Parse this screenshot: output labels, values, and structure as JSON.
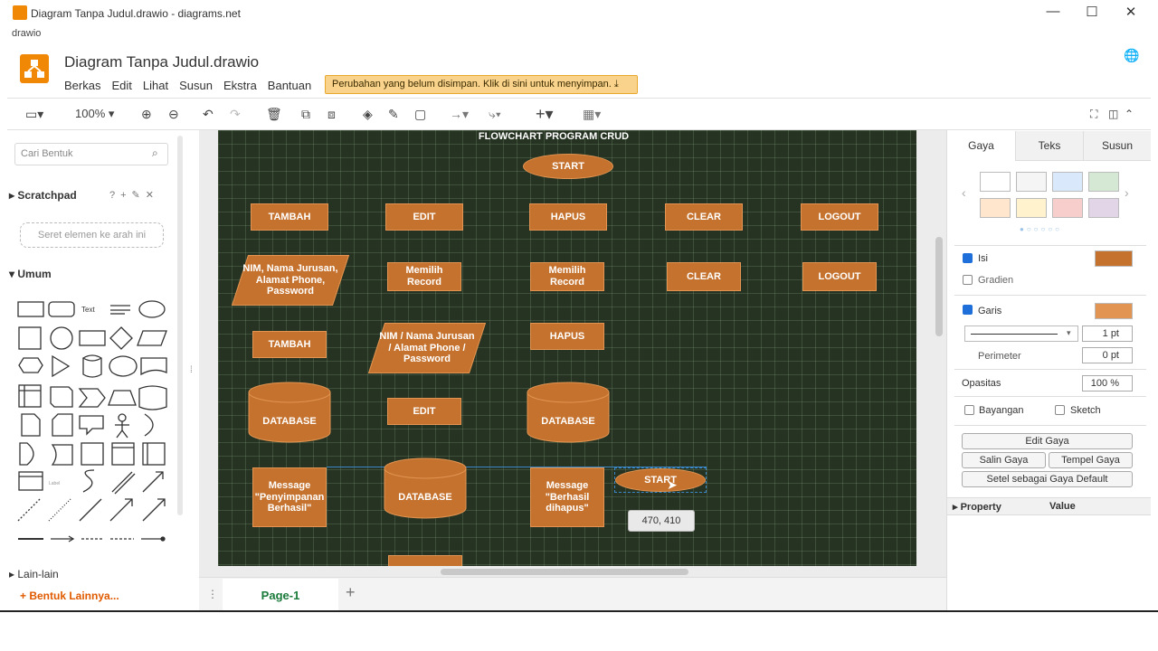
{
  "window": {
    "title": "Diagram Tanpa Judul.drawio - diagrams.net",
    "app_label": "drawio",
    "minimize": "—",
    "maximize": "☐",
    "close": "✕"
  },
  "header": {
    "doc_title": "Diagram Tanpa Judul.drawio",
    "menus": [
      "Berkas",
      "Edit",
      "Lihat",
      "Susun",
      "Ekstra",
      "Bantuan"
    ],
    "unsaved_notice": "Perubahan yang belum disimpan. Klik di sini untuk menyimpan."
  },
  "toolbar": {
    "zoom": "100%"
  },
  "left": {
    "search_placeholder": "Cari Bentuk",
    "scratchpad_title": "Scratchpad",
    "scratch_drop": "Seret elemen ke arah ini",
    "general_title": "Umum",
    "other_title": "Lain-lain",
    "more_shapes": "Bentuk Lainnya..."
  },
  "diagram": {
    "title": "FLOWCHART PROGRAM CRUD",
    "nodes": {
      "start_top": "START",
      "tambah1": "TAMBAH",
      "edit1": "EDIT",
      "hapus1": "HAPUS",
      "clear1": "CLEAR",
      "logout1": "LOGOUT",
      "input1": "NIM, Nama Jurusan, Alamat Phone, Password",
      "memilih1": "Memilih Record",
      "memilih2": "Memilih Record",
      "clear2": "CLEAR",
      "logout2": "LOGOUT",
      "tambah2": "TAMBAH",
      "input2": "NIM / Nama Jurusan / Alamat Phone / Password",
      "hapus2": "HAPUS",
      "db1": "DATABASE",
      "edit2": "EDIT",
      "db2": "DATABASE",
      "msg1": "Message \"Penyimpanan Berhasil\"",
      "db3": "DATABASE",
      "msg2": "Message \"Berhasil dihapus\"",
      "start_drag": "START"
    },
    "coord_tooltip": "470, 410"
  },
  "page_tab": "Page-1",
  "right": {
    "tabs": [
      "Gaya",
      "Teks",
      "Susun"
    ],
    "swatches": [
      "#ffffff",
      "#f5f5f5",
      "#dae8fc",
      "#d5e8d4",
      "#ffe6cc",
      "#fff2cc",
      "#f8cecc",
      "#e1d5e7"
    ],
    "fill_label": "Isi",
    "fill_color": "#c5722e",
    "gradient_label": "Gradien",
    "line_label": "Garis",
    "line_color": "#e29552",
    "line_width": "1 pt",
    "perimeter_label": "Perimeter",
    "perimeter_value": "0 pt",
    "opacity_label": "Opasitas",
    "opacity_value": "100 %",
    "shadow_label": "Bayangan",
    "sketch_label": "Sketch",
    "edit_style": "Edit Gaya",
    "copy_style": "Salin Gaya",
    "paste_style": "Tempel Gaya",
    "set_default": "Setel sebagai Gaya Default",
    "prop_col": "Property",
    "value_col": "Value"
  }
}
